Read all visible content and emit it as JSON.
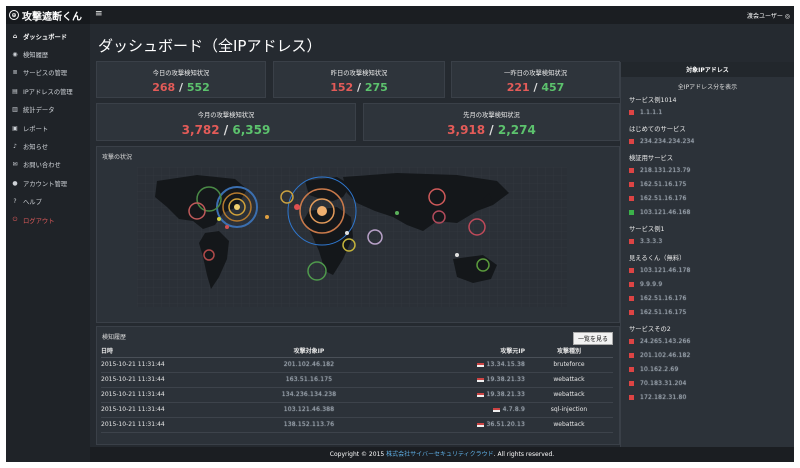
{
  "app": {
    "brand": "攻撃遮断くん"
  },
  "topbar": {
    "user": "渡会ユーザー ◎"
  },
  "sidebar": {
    "items": [
      {
        "label": "ダッシュボード",
        "icon": "home-icon",
        "active": true
      },
      {
        "label": "検知履歴",
        "icon": "eye-icon"
      },
      {
        "label": "サービスの管理",
        "icon": "list-icon"
      },
      {
        "label": "IPアドレスの管理",
        "icon": "document-icon"
      },
      {
        "label": "統計データ",
        "icon": "bar-chart-icon"
      },
      {
        "label": "レポート",
        "icon": "report-icon"
      },
      {
        "label": "お知らせ",
        "icon": "bell-icon"
      },
      {
        "label": "お問い合わせ",
        "icon": "mail-icon"
      },
      {
        "label": "アカウント管理",
        "icon": "user-icon"
      },
      {
        "label": "ヘルプ",
        "icon": "help-icon"
      },
      {
        "label": "ログアウト",
        "icon": "power-icon",
        "logout": true
      }
    ]
  },
  "page": {
    "title": "ダッシュボード（全IPアドレス）"
  },
  "stats": {
    "today": {
      "label": "今日の攻撃検知状況",
      "a": "268",
      "b": "552"
    },
    "yesterday": {
      "label": "昨日の攻撃検知状況",
      "a": "152",
      "b": "275"
    },
    "day_before": {
      "label": "一昨日の攻撃検知状況",
      "a": "221",
      "b": "457"
    },
    "this_month": {
      "label": "今月の攻撃検知状況",
      "a": "3,782",
      "b": "6,359"
    },
    "last_month": {
      "label": "先月の攻撃検知状況",
      "a": "3,918",
      "b": "2,274"
    }
  },
  "map": {
    "title": "攻撃の状況"
  },
  "history": {
    "title": "検知履歴",
    "button": "一覧を見る",
    "columns": [
      "日時",
      "攻撃対象IP",
      "攻撃元IP",
      "攻撃種別"
    ],
    "rows": [
      {
        "date": "2015-10-21 11:31:44",
        "target": "201.102.46.182",
        "source": "13.34.15.38",
        "type": "bruteforce"
      },
      {
        "date": "2015-10-21 11:31:44",
        "target": "163.51.16.175",
        "source": "19.38.21.33",
        "type": "webattack"
      },
      {
        "date": "2015-10-21 11:31:44",
        "target": "134.236.134.238",
        "source": "19.38.21.33",
        "type": "webattack"
      },
      {
        "date": "2015-10-21 11:31:44",
        "target": "103.121.46.388",
        "source": "4.7.8.9",
        "type": "sql-injection"
      },
      {
        "date": "2015-10-21 11:31:44",
        "target": "138.152.113.76",
        "source": "36.51.20.13",
        "type": "webattack"
      }
    ]
  },
  "right": {
    "title": "対象IPアドレス",
    "subtitle": "全IPアドレス分を表示",
    "groups": [
      {
        "name": "サービス例1014",
        "items": [
          {
            "ip": "1.1.1.1",
            "status": "red"
          }
        ]
      },
      {
        "name": "はじめてのサービス",
        "items": [
          {
            "ip": "234.234.234.234",
            "status": "red"
          }
        ]
      },
      {
        "name": "検証用サービス",
        "items": [
          {
            "ip": "218.131.213.79",
            "status": "red"
          },
          {
            "ip": "162.51.16.175",
            "status": "red"
          },
          {
            "ip": "162.51.16.176",
            "status": "red"
          },
          {
            "ip": "103.121.46.168",
            "status": "green"
          }
        ]
      },
      {
        "name": "サービス例1",
        "items": [
          {
            "ip": "3.3.3.3",
            "status": "red"
          }
        ]
      },
      {
        "name": "見えるくん（無料）",
        "items": [
          {
            "ip": "103.121.46.178",
            "status": "red"
          },
          {
            "ip": "9.9.9.9",
            "status": "red"
          },
          {
            "ip": "162.51.16.176",
            "status": "red"
          },
          {
            "ip": "162.51.16.175",
            "status": "red"
          }
        ]
      },
      {
        "name": "サービスその2",
        "items": [
          {
            "ip": "24.265.143.266",
            "status": "red"
          },
          {
            "ip": "201.102.46.182",
            "status": "red"
          },
          {
            "ip": "10.162.2.69",
            "status": "red"
          },
          {
            "ip": "70.183.31.204",
            "status": "red"
          },
          {
            "ip": "172.182.31.80",
            "status": "red"
          }
        ]
      }
    ]
  },
  "footer": {
    "prefix": "Copyright © 2015 ",
    "company": "株式会社サイバーセキュリティクラウド",
    "suffix": ". All rights reserved."
  }
}
